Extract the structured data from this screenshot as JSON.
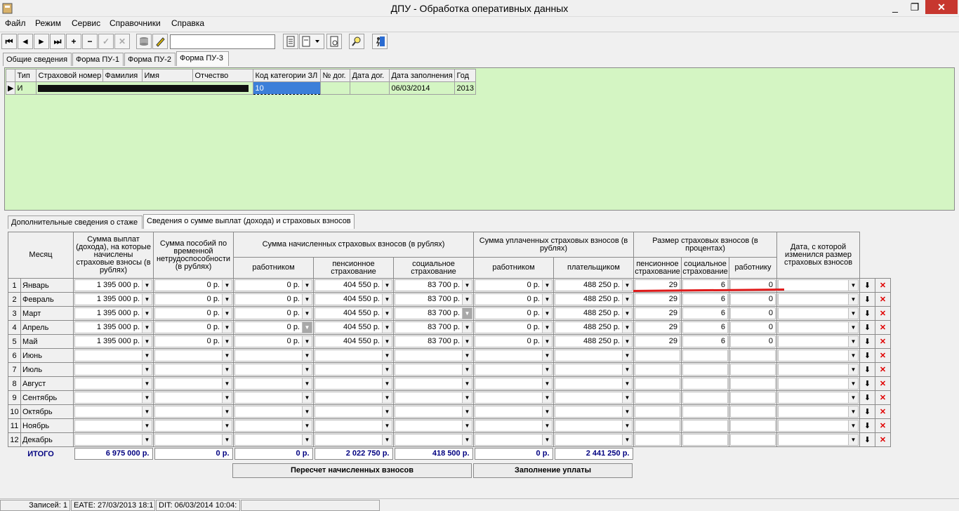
{
  "window": {
    "title": "ДПУ - Обработка оперативных данных",
    "min": "_",
    "max": "❐",
    "close": "✕"
  },
  "menu": [
    "Файл",
    "Режим",
    "Сервис",
    "Справочники",
    "Справка"
  ],
  "toolbar": {
    "first": "⏮",
    "prev": "◄",
    "next": "►",
    "last": "⏭",
    "add": "+",
    "remove": "−",
    "confirm": "✓",
    "cancel": "✕",
    "search_value": ""
  },
  "top_tabs": [
    "Общие сведения",
    "Форма ПУ-1",
    "Форма ПУ-2",
    "Форма ПУ-3"
  ],
  "grid1": {
    "headers": [
      "Тип",
      "Страховой номер",
      "Фамилия",
      "Имя",
      "Отчество",
      "Код категории ЗЛ",
      "№ дог.",
      "Дата дог.",
      "Дата заполнения",
      "Год"
    ],
    "row": {
      "type": "И",
      "code": "10",
      "contract": "",
      "contract_date": "",
      "fill_date": "06/03/2014",
      "year": "2013"
    }
  },
  "bottom_tabs": [
    "Дополнительные сведения о стаже",
    "Сведения о сумме выплат (дохода) и страховых взносов"
  ],
  "table": {
    "h_month": "Месяц",
    "h_payments": "Сумма выплат (дохода), на которые начислены страховые взносы (в рублях)",
    "h_benefits": "Сумма пособий по временной нетрудоспособности (в рублях)",
    "h_accrued": "Сумма начисленных страховых взносов (в рублях)",
    "h_paid": "Сумма уплаченных страховых взносов (в рублях)",
    "h_rate": "Размер страховых взносов (в процентах)",
    "h_date": "Дата, с которой изменился размер страховых взносов",
    "sub_employee": "работником",
    "sub_pension": "пенсионное страхование",
    "sub_social": "социальное страхование",
    "sub_payer": "плательщиком",
    "sub_worker": "работнику",
    "rows": [
      {
        "n": "1",
        "month": "Январь",
        "pay": "1 395 000 р.",
        "ben": "0 р.",
        "emp": "0 р.",
        "pen": "404 550 р.",
        "soc": "83 700 р.",
        "pemp": "0 р.",
        "ppay": "488 250 р.",
        "rp": "29",
        "rs": "6",
        "rw": "0"
      },
      {
        "n": "2",
        "month": "Февраль",
        "pay": "1 395 000 р.",
        "ben": "0 р.",
        "emp": "0 р.",
        "pen": "404 550 р.",
        "soc": "83 700 р.",
        "pemp": "0 р.",
        "ppay": "488 250 р.",
        "rp": "29",
        "rs": "6",
        "rw": "0"
      },
      {
        "n": "3",
        "month": "Март",
        "pay": "1 395 000 р.",
        "ben": "0 р.",
        "emp": "0 р.",
        "pen": "404 550 р.",
        "soc": "83 700 р.",
        "pemp": "0 р.",
        "ppay": "488 250 р.",
        "rp": "29",
        "rs": "6",
        "rw": "0"
      },
      {
        "n": "4",
        "month": "Апрель",
        "pay": "1 395 000 р.",
        "ben": "0 р.",
        "emp": "0 р.",
        "pen": "404 550 р.",
        "soc": "83 700 р.",
        "pemp": "0 р.",
        "ppay": "488 250 р.",
        "rp": "29",
        "rs": "6",
        "rw": "0"
      },
      {
        "n": "5",
        "month": "Май",
        "pay": "1 395 000 р.",
        "ben": "0 р.",
        "emp": "0 р.",
        "pen": "404 550 р.",
        "soc": "83 700 р.",
        "pemp": "0 р.",
        "ppay": "488 250 р.",
        "rp": "29",
        "rs": "6",
        "rw": "0"
      },
      {
        "n": "6",
        "month": "Июнь",
        "pay": "",
        "ben": "",
        "emp": "",
        "pen": "",
        "soc": "",
        "pemp": "",
        "ppay": "",
        "rp": "",
        "rs": "",
        "rw": ""
      },
      {
        "n": "7",
        "month": "Июль",
        "pay": "",
        "ben": "",
        "emp": "",
        "pen": "",
        "soc": "",
        "pemp": "",
        "ppay": "",
        "rp": "",
        "rs": "",
        "rw": ""
      },
      {
        "n": "8",
        "month": "Август",
        "pay": "",
        "ben": "",
        "emp": "",
        "pen": "",
        "soc": "",
        "pemp": "",
        "ppay": "",
        "rp": "",
        "rs": "",
        "rw": ""
      },
      {
        "n": "9",
        "month": "Сентябрь",
        "pay": "",
        "ben": "",
        "emp": "",
        "pen": "",
        "soc": "",
        "pemp": "",
        "ppay": "",
        "rp": "",
        "rs": "",
        "rw": ""
      },
      {
        "n": "10",
        "month": "Октябрь",
        "pay": "",
        "ben": "",
        "emp": "",
        "pen": "",
        "soc": "",
        "pemp": "",
        "ppay": "",
        "rp": "",
        "rs": "",
        "rw": ""
      },
      {
        "n": "11",
        "month": "Ноябрь",
        "pay": "",
        "ben": "",
        "emp": "",
        "pen": "",
        "soc": "",
        "pemp": "",
        "ppay": "",
        "rp": "",
        "rs": "",
        "rw": ""
      },
      {
        "n": "12",
        "month": "Декабрь",
        "pay": "",
        "ben": "",
        "emp": "",
        "pen": "",
        "soc": "",
        "pemp": "",
        "ppay": "",
        "rp": "",
        "rs": "",
        "rw": ""
      }
    ],
    "total_label": "ИТОГО",
    "totals": {
      "pay": "6 975 000 р.",
      "ben": "0 р.",
      "emp": "0 р.",
      "pen": "2 022 750 р.",
      "soc": "418 500 р.",
      "pemp": "0 р.",
      "ppay": "2 441 250 р."
    }
  },
  "buttons": {
    "recalc": "Пересчет начисленных взносов",
    "fill_pay": "Заполнение уплаты"
  },
  "status": {
    "records": "Записей: 1",
    "create": "EATE: 27/03/2013 18:1",
    "edit": "DIT: 06/03/2014 10:04:"
  },
  "colors": {
    "panel_green": "#d4f5c3",
    "total_text": "#000080",
    "delete_red": "#e00000",
    "annotation_red": "#e01a1a"
  }
}
